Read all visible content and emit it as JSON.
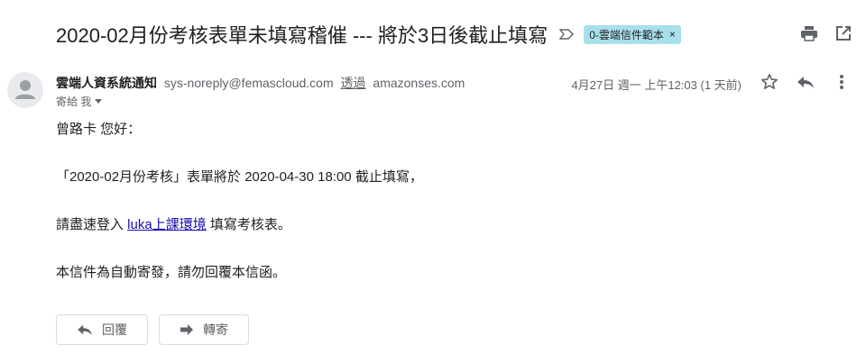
{
  "email": {
    "subject": "2020-02月份考核表單未填寫稽催 --- 將於3日後截止填寫",
    "label": "0-雲端信件範本",
    "label_remove": "×",
    "sender": {
      "name": "雲端人資系統通知",
      "address": "sys-noreply@femascloud.com",
      "via_label": "透過",
      "via_domain": "amazonses.com"
    },
    "recipient": "寄給 我",
    "date": "4月27日 週一 上午12:03 (1 天前)",
    "body": {
      "greeting": "曾路卡 您好：",
      "line1": "「2020-02月份考核」表單將於 2020-04-30 18:00 截止填寫，",
      "line2_prefix": "請盡速登入 ",
      "line2_link": "luka上課環境",
      "line2_suffix": " 填寫考核表。",
      "line3": "本信件為自動寄發，請勿回覆本信函。"
    }
  },
  "actions": {
    "reply": "回覆",
    "forward": "轉寄"
  },
  "icons": {
    "importance": "importance-arrow-icon",
    "print": "print-icon",
    "new_window": "open-in-new-window-icon",
    "star": "star-icon",
    "reply": "reply-icon",
    "more": "more-vertical-icon",
    "forward": "forward-icon",
    "dropdown": "caret-down-icon"
  },
  "colors": {
    "label_bg": "#a8e0ea",
    "link": "#1a0dab",
    "muted": "#5f6368"
  }
}
